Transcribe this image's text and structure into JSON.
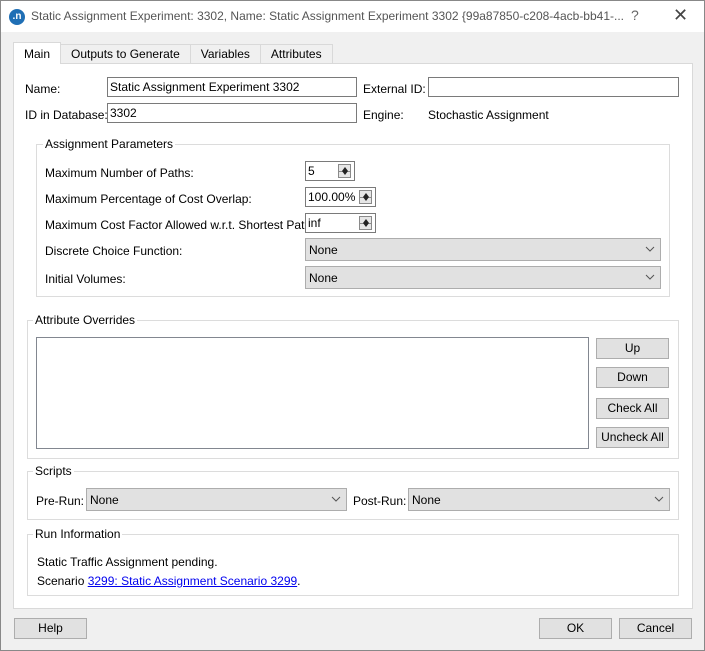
{
  "window": {
    "title": "Static Assignment Experiment: 3302, Name: Static Assignment Experiment 3302  {99a87850-c208-4acb-bb41-...",
    "app_icon_letter": ".n",
    "help_glyph": "?",
    "close_glyph": "✕"
  },
  "tabs": [
    {
      "label": "Main",
      "active": true
    },
    {
      "label": "Outputs to Generate",
      "active": false
    },
    {
      "label": "Variables",
      "active": false
    },
    {
      "label": "Attributes",
      "active": false
    }
  ],
  "main": {
    "name_label": "Name:",
    "name_value": "Static Assignment Experiment 3302",
    "external_id_label": "External ID:",
    "external_id_value": "",
    "id_label": "ID in Database:",
    "id_value": "3302",
    "engine_label": "Engine:",
    "engine_value": "Stochastic Assignment"
  },
  "assignment_parameters": {
    "title": "Assignment Parameters",
    "max_paths_label": "Maximum Number of Paths:",
    "max_paths_value": "5",
    "max_overlap_label": "Maximum Percentage of Cost Overlap:",
    "max_overlap_value": "100.00%",
    "max_cost_factor_label": "Maximum Cost Factor Allowed w.r.t. Shortest Path:",
    "max_cost_factor_value": "inf",
    "discrete_choice_label": "Discrete Choice Function:",
    "discrete_choice_value": "None",
    "initial_volumes_label": "Initial Volumes:",
    "initial_volumes_value": "None"
  },
  "attribute_overrides": {
    "title": "Attribute Overrides",
    "items": [],
    "up_label": "Up",
    "down_label": "Down",
    "check_all_label": "Check All",
    "uncheck_all_label": "Uncheck All"
  },
  "scripts": {
    "title": "Scripts",
    "pre_run_label": "Pre-Run:",
    "pre_run_value": "None",
    "post_run_label": "Post-Run:",
    "post_run_value": "None"
  },
  "run_information": {
    "title": "Run Information",
    "status_text": "Static Traffic Assignment pending.",
    "scenario_prefix": "Scenario ",
    "scenario_link": "3299: Static Assignment Scenario 3299",
    "scenario_suffix": "."
  },
  "footer": {
    "help_label": "Help",
    "ok_label": "OK",
    "cancel_label": "Cancel"
  }
}
